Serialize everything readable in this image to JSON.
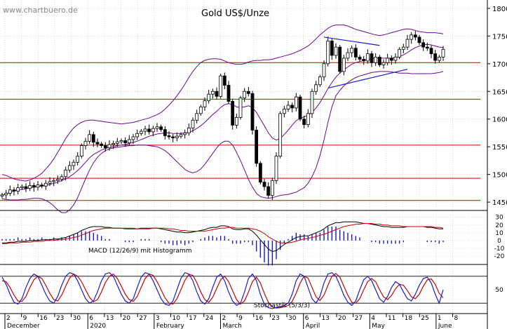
{
  "chart_data": {
    "type": "candlestick",
    "source_label": "www.chartbuero.de",
    "title": "Gold US$/Unze",
    "price_axis": {
      "ticks": [
        1450,
        1500,
        1550,
        1600,
        1650,
        1700,
        1750,
        1800
      ],
      "ylim": [
        1440,
        1810
      ]
    },
    "macd_axis": {
      "ticks": [
        30,
        20,
        10,
        0,
        -10,
        -20
      ],
      "ylim": [
        -28,
        36
      ]
    },
    "stoch_axis": {
      "ticks": [
        50
      ],
      "ylim": [
        0,
        100
      ]
    },
    "horizontal_levels": [
      1453,
      1493,
      1553,
      1636,
      1702
    ],
    "day_ticks": [
      "2",
      "9",
      "16",
      "23",
      "30",
      "6",
      "13",
      "20",
      "27",
      "3",
      "10",
      "17",
      "24",
      "2",
      "9",
      "16",
      "23",
      "30",
      "6",
      "13",
      "20",
      "27",
      "4",
      "11",
      "18",
      "25",
      "1",
      "8"
    ],
    "month_labels": [
      "December",
      "2020",
      "February",
      "March",
      "April",
      "May",
      "June"
    ],
    "macd_label": "MACD (12/26/9) mit Histogramm",
    "stoch_label": "Stochastik (5/3/3)",
    "price_close": [
      1463,
      1466,
      1472,
      1470,
      1476,
      1478,
      1475,
      1480,
      1477,
      1481,
      1479,
      1484,
      1487,
      1489,
      1491,
      1496,
      1508,
      1516,
      1522,
      1533,
      1552,
      1560,
      1572,
      1558,
      1555,
      1552,
      1548,
      1554,
      1556,
      1559,
      1561,
      1557,
      1563,
      1568,
      1574,
      1578,
      1582,
      1577,
      1583,
      1586,
      1581,
      1570,
      1568,
      1566,
      1569,
      1572,
      1575,
      1584,
      1598,
      1610,
      1622,
      1633,
      1645,
      1650,
      1641,
      1678,
      1661,
      1632,
      1589,
      1603,
      1638,
      1650,
      1646,
      1580,
      1520,
      1486,
      1478,
      1462,
      1489,
      1533,
      1610,
      1618,
      1625,
      1620,
      1640,
      1600,
      1590,
      1610,
      1650,
      1662,
      1676,
      1700,
      1741,
      1715,
      1730,
      1686,
      1710,
      1720,
      1728,
      1712,
      1708,
      1705,
      1718,
      1702,
      1712,
      1698,
      1702,
      1710,
      1706,
      1712,
      1726,
      1730,
      1744,
      1752,
      1748,
      1738,
      1730,
      1728,
      1718,
      1706,
      1712,
      1726
    ],
    "ma_short": [
      1462,
      1465,
      1468,
      1470,
      1472,
      1473,
      1474,
      1476,
      1477,
      1478,
      1479,
      1480,
      1482,
      1484,
      1486,
      1489,
      1492,
      1496,
      1501,
      1507,
      1514,
      1522,
      1530,
      1536,
      1540,
      1544,
      1547,
      1549,
      1550,
      1552,
      1553,
      1554,
      1556,
      1558,
      1560,
      1563,
      1566,
      1569,
      1571,
      1573,
      1574,
      1575,
      1575,
      1574,
      1574,
      1574,
      1575,
      1576,
      1579,
      1583,
      1588,
      1594,
      1601,
      1608,
      1614,
      1621,
      1626,
      1628,
      1626,
      1622,
      1621,
      1622,
      1624,
      1621,
      1612,
      1600,
      1588,
      1575,
      1566,
      1562,
      1565,
      1572,
      1580,
      1589,
      1597,
      1601,
      1604,
      1607,
      1612,
      1620,
      1630,
      1642,
      1655,
      1666,
      1676,
      1683,
      1689,
      1694,
      1699,
      1702,
      1704,
      1706,
      1708,
      1709,
      1710,
      1710,
      1710,
      1710,
      1710,
      1711,
      1713,
      1716,
      1720,
      1725,
      1729,
      1732,
      1734,
      1735,
      1734,
      1732,
      1730,
      1729
    ],
    "bb_upper": [
      1500,
      1498,
      1495,
      1492,
      1490,
      1489,
      1488,
      1490,
      1493,
      1497,
      1502,
      1510,
      1518,
      1528,
      1540,
      1552,
      1565,
      1575,
      1584,
      1590,
      1594,
      1597,
      1598,
      1598,
      1597,
      1596,
      1595,
      1594,
      1593,
      1592,
      1591,
      1592,
      1593,
      1594,
      1596,
      1598,
      1600,
      1602,
      1605,
      1608,
      1612,
      1618,
      1625,
      1633,
      1642,
      1652,
      1663,
      1675,
      1686,
      1695,
      1702,
      1706,
      1708,
      1709,
      1709,
      1708,
      1705,
      1702,
      1700,
      1699,
      1699,
      1700,
      1703,
      1705,
      1706,
      1706,
      1707,
      1707,
      1708,
      1710,
      1712,
      1714,
      1716,
      1718,
      1721,
      1724,
      1728,
      1732,
      1738,
      1745,
      1752,
      1758,
      1764,
      1768,
      1770,
      1770,
      1770,
      1768,
      1765,
      1762,
      1760,
      1758,
      1756,
      1754,
      1752,
      1751,
      1752,
      1754,
      1756,
      1758,
      1760,
      1762,
      1763,
      1762,
      1760,
      1758,
      1757,
      1756,
      1756,
      1756,
      1755,
      1754
    ],
    "bb_lower": [
      1456,
      1455,
      1454,
      1454,
      1454,
      1455,
      1455,
      1456,
      1457,
      1457,
      1456,
      1453,
      1449,
      1443,
      1436,
      1431,
      1431,
      1436,
      1445,
      1458,
      1475,
      1492,
      1508,
      1521,
      1531,
      1538,
      1543,
      1546,
      1548,
      1549,
      1550,
      1551,
      1552,
      1552,
      1553,
      1553,
      1553,
      1552,
      1551,
      1550,
      1547,
      1543,
      1537,
      1530,
      1523,
      1516,
      1509,
      1505,
      1503,
      1505,
      1510,
      1518,
      1528,
      1538,
      1548,
      1556,
      1560,
      1560,
      1553,
      1540,
      1525,
      1508,
      1491,
      1477,
      1466,
      1460,
      1458,
      1457,
      1458,
      1460,
      1462,
      1463,
      1464,
      1466,
      1468,
      1472,
      1476,
      1484,
      1496,
      1512,
      1534,
      1562,
      1594,
      1622,
      1642,
      1652,
      1660,
      1666,
      1671,
      1675,
      1678,
      1680,
      1682,
      1684,
      1685,
      1686,
      1686,
      1686,
      1685,
      1684,
      1683,
      1683,
      1683,
      1682,
      1682,
      1682,
      1682,
      1682,
      1682,
      1683,
      1684,
      1686
    ],
    "channel_lines": [
      {
        "from": [
          81,
          1748
        ],
        "to": [
          95,
          1733
        ]
      },
      {
        "from": [
          82,
          1656
        ],
        "to": [
          102,
          1690
        ]
      }
    ],
    "macd": [
      -3,
      -3,
      -2,
      -2,
      -1,
      -1,
      -1,
      0,
      0,
      0,
      1,
      1,
      1,
      2,
      2,
      3,
      4,
      6,
      8,
      10,
      13,
      15,
      17,
      18,
      18,
      18,
      17,
      17,
      16,
      16,
      16,
      15,
      15,
      15,
      15,
      16,
      16,
      16,
      16,
      16,
      15,
      14,
      13,
      12,
      11,
      11,
      10,
      10,
      11,
      12,
      13,
      14,
      16,
      17,
      17,
      19,
      19,
      18,
      15,
      14,
      14,
      15,
      15,
      12,
      7,
      1,
      -5,
      -11,
      -14,
      -13,
      -9,
      -5,
      -2,
      1,
      4,
      5,
      6,
      6,
      8,
      10,
      12,
      15,
      19,
      21,
      23,
      23,
      24,
      24,
      24,
      24,
      23,
      22,
      22,
      21,
      20,
      19,
      18,
      18,
      17,
      17,
      17,
      17,
      18,
      18,
      18,
      18,
      18,
      17,
      17,
      16,
      15,
      15
    ],
    "macd_signal": [
      -4,
      -4,
      -3,
      -3,
      -3,
      -2,
      -2,
      -2,
      -1,
      -1,
      -1,
      0,
      0,
      0,
      1,
      1,
      2,
      3,
      4,
      5,
      7,
      9,
      11,
      13,
      14,
      15,
      16,
      16,
      16,
      16,
      16,
      16,
      16,
      16,
      15,
      15,
      15,
      15,
      16,
      16,
      16,
      16,
      15,
      15,
      14,
      13,
      13,
      12,
      12,
      12,
      12,
      12,
      13,
      14,
      15,
      16,
      16,
      17,
      17,
      16,
      16,
      16,
      16,
      15,
      14,
      12,
      9,
      5,
      2,
      -1,
      -3,
      -3,
      -3,
      -2,
      -1,
      1,
      2,
      3,
      4,
      5,
      7,
      8,
      10,
      12,
      14,
      16,
      18,
      19,
      20,
      21,
      21,
      22,
      22,
      22,
      21,
      21,
      20,
      20,
      19,
      19,
      19,
      18,
      18,
      18,
      18,
      18,
      18,
      18,
      18,
      17,
      17,
      16
    ],
    "stoch_k": [
      78,
      62,
      40,
      22,
      18,
      30,
      55,
      75,
      85,
      80,
      60,
      40,
      25,
      20,
      35,
      60,
      80,
      88,
      85,
      70,
      50,
      30,
      20,
      25,
      45,
      70,
      85,
      88,
      80,
      60,
      40,
      25,
      20,
      30,
      55,
      78,
      88,
      85,
      70,
      50,
      30,
      18,
      15,
      25,
      50,
      75,
      88,
      85,
      70,
      45,
      25,
      18,
      30,
      55,
      78,
      85,
      70,
      45,
      25,
      15,
      20,
      45,
      75,
      85,
      70,
      40,
      18,
      10,
      8,
      10,
      12,
      15,
      20,
      40,
      70,
      85,
      80,
      55,
      30,
      20,
      35,
      65,
      85,
      88,
      80,
      60,
      38,
      22,
      15,
      25,
      50,
      72,
      80,
      70,
      50,
      30,
      22,
      35,
      55,
      68,
      62,
      45,
      30,
      25,
      40,
      60,
      75,
      78,
      65,
      40,
      20,
      50
    ],
    "stoch_d": [
      70,
      68,
      55,
      38,
      25,
      24,
      35,
      55,
      72,
      80,
      75,
      60,
      42,
      28,
      25,
      38,
      58,
      76,
      85,
      80,
      68,
      50,
      33,
      23,
      28,
      45,
      66,
      80,
      85,
      75,
      58,
      40,
      28,
      24,
      35,
      55,
      75,
      85,
      82,
      68,
      50,
      32,
      20,
      18,
      30,
      50,
      71,
      84,
      82,
      66,
      45,
      28,
      22,
      33,
      53,
      72,
      80,
      68,
      48,
      28,
      18,
      25,
      45,
      68,
      78,
      65,
      42,
      22,
      12,
      9,
      10,
      12,
      15,
      24,
      42,
      65,
      80,
      76,
      55,
      34,
      26,
      38,
      60,
      80,
      86,
      78,
      58,
      38,
      22,
      20,
      30,
      50,
      68,
      75,
      68,
      50,
      34,
      28,
      37,
      52,
      62,
      60,
      48,
      34,
      30,
      40,
      58,
      72,
      74,
      62,
      42,
      32
    ]
  }
}
